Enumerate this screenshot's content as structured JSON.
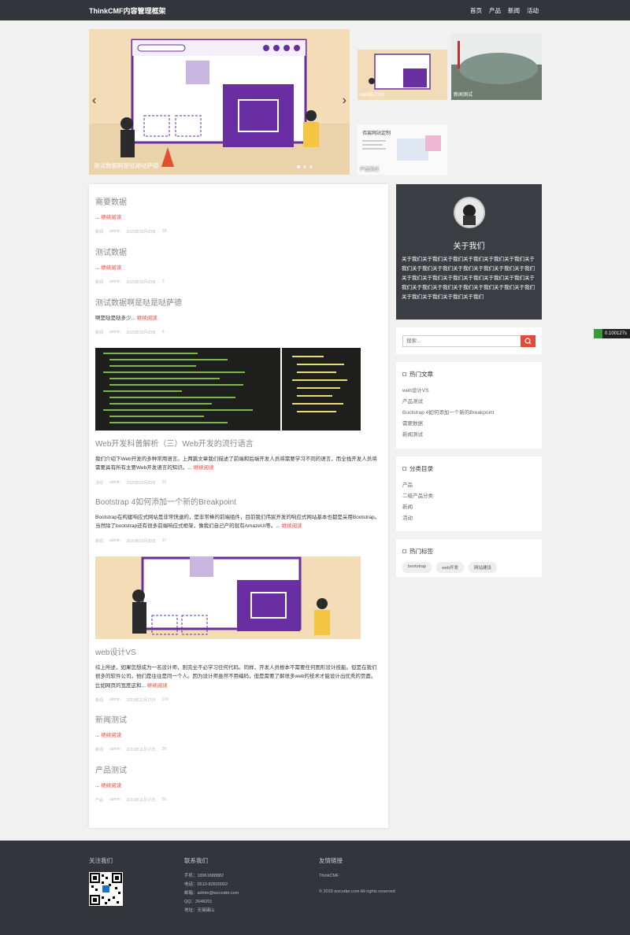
{
  "navbar": {
    "brand": "ThinkCMF内容管理框架",
    "items": [
      "首页",
      "产品",
      "新闻",
      "活动"
    ]
  },
  "carousel": {
    "caption": "测试数据啊是哒是哒萨德",
    "prev": "‹",
    "next": "›"
  },
  "thumbs": [
    {
      "caption": "web设计VS"
    },
    {
      "caption": "新闻测试"
    },
    {
      "caption": "产品测试",
      "heading": "伟宸网站定制"
    }
  ],
  "posts": [
    {
      "title": "需要数据",
      "excerpt": "...",
      "more": "继续阅读",
      "category": "新闻",
      "author": "admin",
      "date": "2020年03月20日",
      "views": "38"
    },
    {
      "title": "测试数据",
      "excerpt": "...",
      "more": "继续阅读",
      "category": "新闻",
      "author": "admin",
      "date": "2020年03月20日",
      "views": "3"
    },
    {
      "title": "测试数据啊是哒是哒萨德",
      "excerpt": "啊是哒是哒多少...",
      "more": "继续阅读",
      "category": "新闻",
      "author": "admin",
      "date": "2020年03月20日",
      "views": "8"
    },
    {
      "title": "Web开发科普解析（三）Web开发的流行语言",
      "excerpt": "我们介绍下Web开发的多种常用语言。上两篇文章我们描述了前端和后端开发人员将需要学习不同的语言，而全栈开发人员将需要具有所有主要Web开发语言的知识。...",
      "more": "继续阅读",
      "category": "活动",
      "author": "admin",
      "date": "2020年03月20日",
      "views": "32"
    },
    {
      "title": "Bootstrap 4如何添加一个新的Breakpoint",
      "excerpt": "Bootstrap在构建响应式网站是非常快速的，是非常棒的前端组件，目前我们伟宸开发的响应式网站基本也都是采用Bootstrap。当然除了bootstrap还有很多前端响应式框架，像我们自己产的就有AmazeUI等。...",
      "more": "继续阅读",
      "category": "新闻",
      "author": "admin",
      "date": "2020年03月20日",
      "views": "37"
    },
    {
      "title": "web设计VS",
      "excerpt": "综上所述，如果您想成为一名设计师，则完全不必学习任何代码。同样，开发人员根本不需要任何图形设计技能。但是在我们很多的软件公司，他们是往往是同一个人。因为设计师虽然不用编码，但是需要了解很多web的技术才能设计出优秀的页面。比如网页的宽度这和...",
      "more": "继续阅读",
      "category": "新闻",
      "author": "admin",
      "date": "2019年11月17日",
      "views": "109"
    },
    {
      "title": "新闻测试",
      "excerpt": "...",
      "more": "继续阅读",
      "category": "新闻",
      "author": "admin",
      "date": "2019年11月17日",
      "views": "28"
    },
    {
      "title": "产品测试",
      "excerpt": "...",
      "more": "继续阅读",
      "category": "产品",
      "author": "admin",
      "date": "2019年11月17日",
      "views": "56"
    }
  ],
  "about": {
    "title": "关于我们",
    "text": "关于我们关于我们关于我们关于我们关于我们关于我们关于我们关于我们关于我们关于我们关于我们关于我们关于我们关于我们关于我们关于我们关于我们关于我们关于我们关于我们关于我们关于我们关于我们关于我们关于我们关于我们关于我们关于我们关于我们关于我们"
  },
  "search": {
    "placeholder": "搜索..."
  },
  "hot_posts": {
    "title": "热门文章",
    "items": [
      "web设计VS",
      "产品测试",
      "Bootstrap 4如何添加一个新的Breakpoint",
      "需要数据",
      "新闻测试"
    ]
  },
  "categories": {
    "title": "分类目录",
    "items": [
      "产品",
      "二级产品分类",
      "新闻",
      "活动"
    ]
  },
  "hot_tags": {
    "title": "热门标签",
    "items": [
      "bootstrap",
      "web开发",
      "网站建设"
    ]
  },
  "perf": "0.100127s",
  "footer": {
    "follow_title": "关注我们",
    "contact_title": "联系我们",
    "contact_lines": [
      "手机：18961888882",
      "电话：0510-82820002",
      "邮箱：admin@wzcoder.com",
      "QQ：2648201",
      "地址：无锡锡山"
    ],
    "links_title": "友情链接",
    "links": [
      "ThinkCMF"
    ],
    "copyright": "© 2020 wzcoder.com All rights reserved"
  },
  "colors": {
    "navbar": "#32353b",
    "accent": "#e04b3a",
    "sidebar_dark": "#3a3d42"
  }
}
